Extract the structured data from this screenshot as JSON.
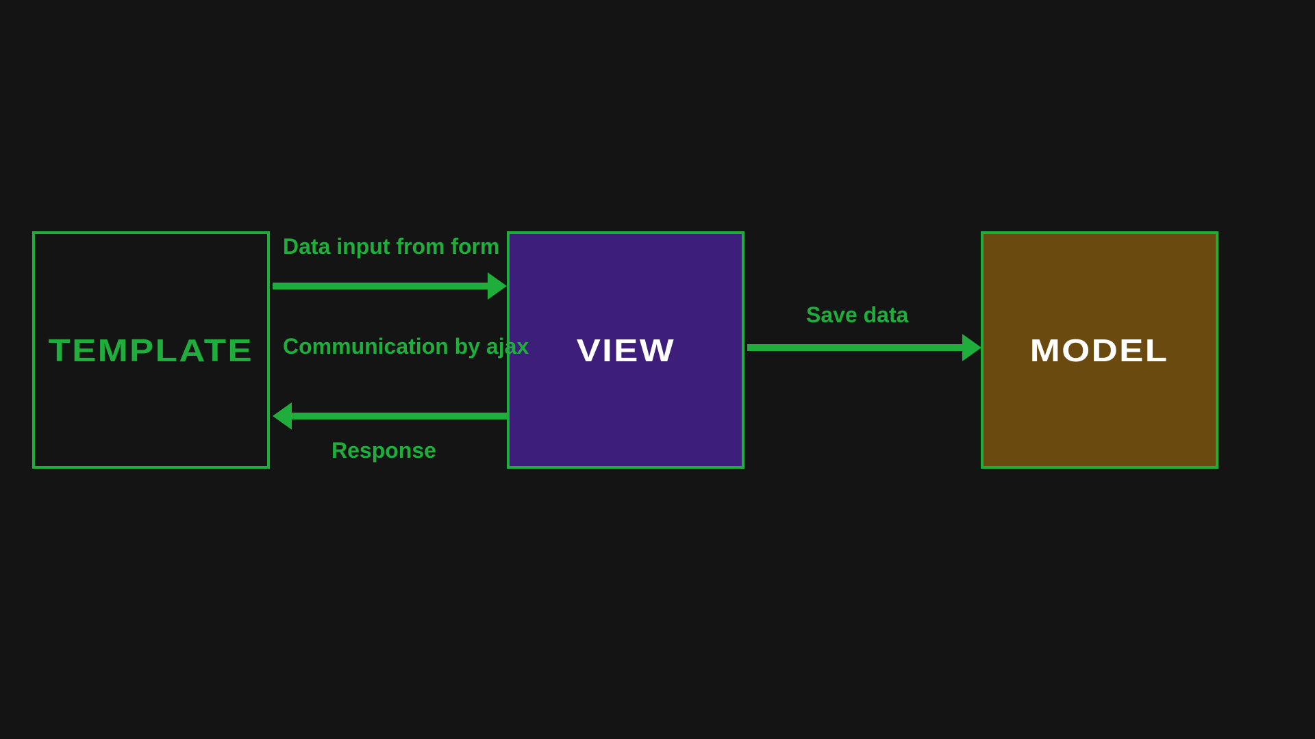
{
  "boxes": {
    "template": {
      "label": "TEMPLATE"
    },
    "view": {
      "label": "VIEW"
    },
    "model": {
      "label": "MODEL"
    }
  },
  "edges": {
    "data_input": {
      "label": "Data input from form"
    },
    "ajax": {
      "label": "Communication by ajax"
    },
    "response": {
      "label": "Response"
    },
    "save_data": {
      "label": "Save data"
    }
  },
  "colors": {
    "background": "#141414",
    "accent": "#1fad3b",
    "view_fill": "#3d1e7a",
    "model_fill": "#6b4a0f",
    "white": "#ffffff"
  }
}
